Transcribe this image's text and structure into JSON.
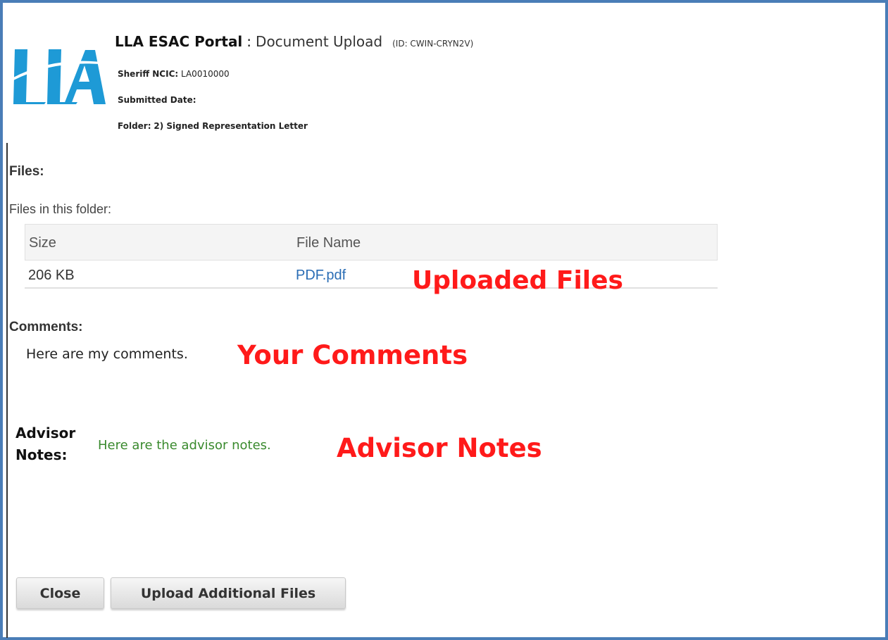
{
  "header": {
    "app_name": "LLA ESAC Portal",
    "separator": ":",
    "page_name": "Document Upload",
    "record_id": "(ID: CWIN-CRYN2V)",
    "logo_text": "LLA",
    "sheriff_ncic_label": "Sheriff NCIC:",
    "sheriff_ncic_value": "LA0010000",
    "submitted_date_label": "Submitted Date:",
    "submitted_date_value": "",
    "folder_label": "Folder:",
    "folder_value": "2) Signed Representation Letter"
  },
  "files": {
    "section_label": "Files:",
    "subtitle": "Files in this folder:",
    "columns": [
      "Size",
      "File Name"
    ],
    "rows": [
      {
        "size": "206 KB",
        "file_name": "PDF.pdf"
      }
    ]
  },
  "comments": {
    "section_label": "Comments:",
    "text": "Here are my comments."
  },
  "advisor": {
    "label_line1": "Advisor",
    "label_line2": "Notes:",
    "text": "Here are the advisor notes."
  },
  "annotations": {
    "uploaded_files": "Uploaded Files",
    "your_comments": "Your Comments",
    "advisor_notes": "Advisor Notes"
  },
  "buttons": {
    "close": "Close",
    "upload_additional": "Upload Additional Files"
  },
  "colors": {
    "frame_border": "#4a7db7",
    "logo": "#1e9ad6",
    "annotation": "#ff1a1a",
    "link": "#2a6db5",
    "advisor_text": "#3a8a2e"
  }
}
